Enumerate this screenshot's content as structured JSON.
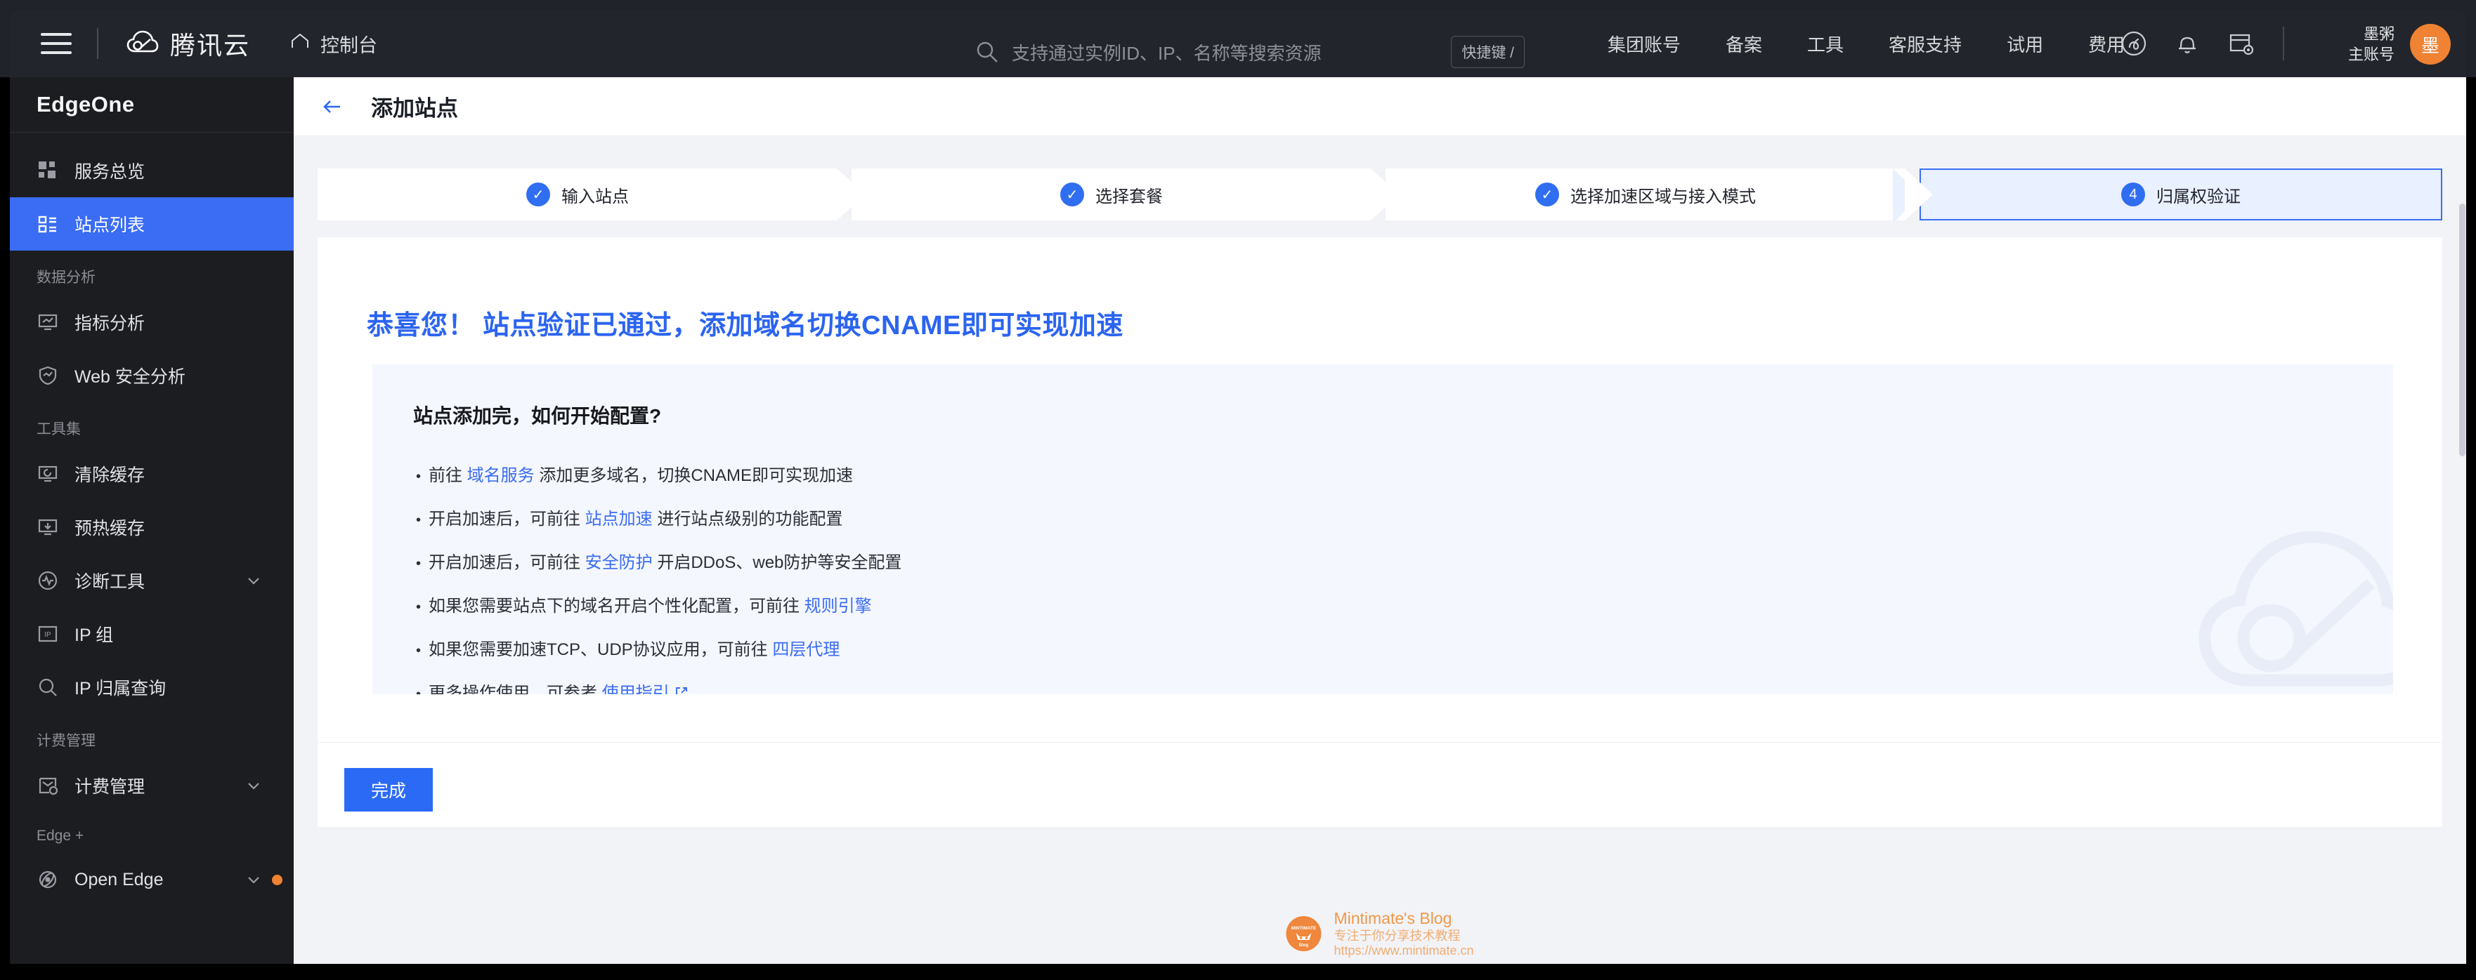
{
  "topbar": {
    "menu_icon": "hamburger-icon",
    "brand": "腾讯云",
    "console_label": "控制台",
    "search": {
      "placeholder": "支持通过实例ID、IP、名称等搜索资源",
      "shortcut_badge": "快捷键 /"
    },
    "nav": [
      {
        "label": "集团账号"
      },
      {
        "label": "备案"
      },
      {
        "label": "工具"
      },
      {
        "label": "客服支持"
      },
      {
        "label": "试用"
      },
      {
        "label": "费用"
      }
    ],
    "icons": [
      {
        "name": "miniprogram-icon"
      },
      {
        "name": "bell-icon"
      },
      {
        "name": "workbench-icon"
      }
    ],
    "user": {
      "name": "墨粥",
      "role": "主账号",
      "avatar_text": "墨"
    }
  },
  "sidebar": {
    "title": "EdgeOne",
    "items": [
      {
        "label": "服务总览",
        "icon": "grid-icon",
        "active": false,
        "type": "item"
      },
      {
        "label": "站点列表",
        "icon": "list-icon",
        "active": true,
        "type": "item"
      },
      {
        "label": "数据分析",
        "type": "group"
      },
      {
        "label": "指标分析",
        "icon": "chart-monitor-icon",
        "active": false,
        "type": "item"
      },
      {
        "label": "Web 安全分析",
        "icon": "shield-chart-icon",
        "active": false,
        "type": "item"
      },
      {
        "label": "工具集",
        "type": "group"
      },
      {
        "label": "清除缓存",
        "icon": "refresh-monitor-icon",
        "active": false,
        "type": "item"
      },
      {
        "label": "预热缓存",
        "icon": "download-monitor-icon",
        "active": false,
        "type": "item"
      },
      {
        "label": "诊断工具",
        "icon": "pulse-circle-icon",
        "active": false,
        "type": "item",
        "expandable": true
      },
      {
        "label": "IP 组",
        "icon": "ip-box-icon",
        "active": false,
        "type": "item"
      },
      {
        "label": "IP 归属查询",
        "icon": "search-icon",
        "active": false,
        "type": "item"
      },
      {
        "label": "计费管理",
        "type": "group"
      },
      {
        "label": "计费管理",
        "icon": "billing-icon",
        "active": false,
        "type": "item",
        "expandable": true
      },
      {
        "label": "Edge +",
        "type": "group"
      },
      {
        "label": "Open Edge",
        "icon": "atom-icon",
        "active": false,
        "type": "item",
        "expandable": true,
        "dot": true
      }
    ]
  },
  "page": {
    "back_icon": "arrow-left-icon",
    "title": "添加站点",
    "steps": [
      {
        "label": "输入站点",
        "state": "done",
        "badge": "✓"
      },
      {
        "label": "选择套餐",
        "state": "done",
        "badge": "✓"
      },
      {
        "label": "选择加速区域与接入模式",
        "state": "done",
        "badge": "✓"
      },
      {
        "label": "归属权验证",
        "state": "active",
        "badge": "4"
      }
    ],
    "congrats": "恭喜您！ 站点验证已通过，添加域名切换CNAME即可实现加速",
    "infobox": {
      "heading": "站点添加完，如何开始配置?",
      "bullets": [
        {
          "before": "前往 ",
          "link": "域名服务",
          "after": " 添加更多域名，切换CNAME即可实现加速",
          "external": false
        },
        {
          "before": "开启加速后，可前往 ",
          "link": "站点加速",
          "after": " 进行站点级别的功能配置",
          "external": false
        },
        {
          "before": "开启加速后，可前往 ",
          "link": "安全防护",
          "after": " 开启DDoS、web防护等安全配置",
          "external": false
        },
        {
          "before": "如果您需要站点下的域名开启个性化配置，可前往 ",
          "link": "规则引擎",
          "after": "",
          "external": false
        },
        {
          "before": "如果您需要加速TCP、UDP协议应用，可前往 ",
          "link": "四层代理",
          "after": "",
          "external": false
        },
        {
          "before": "更多操作使用，可参考 ",
          "link": "使用指引",
          "after": "",
          "external": true
        }
      ],
      "decor_icon": "tencent-cloud-logo-watermark"
    },
    "finish_button": "完成"
  },
  "watermark": {
    "logo_text": "MINTIMATE",
    "title": "Mintimate's Blog",
    "subtitle": "专注于你分享技术教程",
    "url": "https://www.mintimate.cn"
  },
  "colors": {
    "accent_blue": "#2b6af5",
    "sidebar_active": "#3a6cf4",
    "avatar_orange": "#ef8233",
    "topbar_bg": "#22252b",
    "sidebar_bg": "#1b1d21",
    "page_bg": "#f2f3f7",
    "infobox_bg": "#f4f7fd"
  }
}
